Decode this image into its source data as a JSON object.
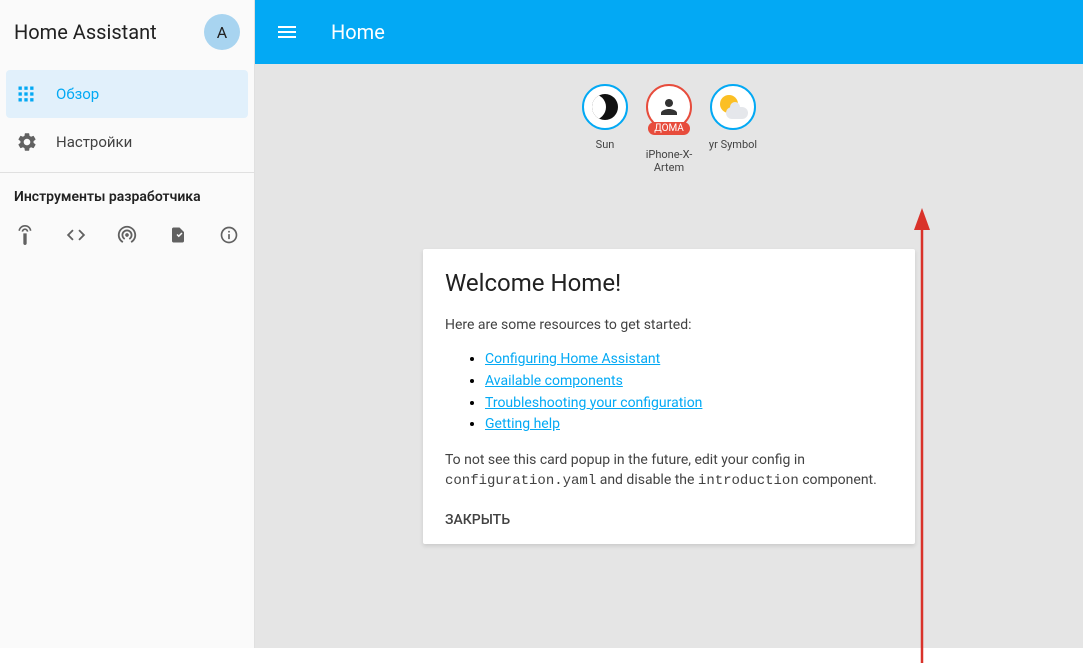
{
  "app": {
    "title": "Home Assistant",
    "avatar_initial": "A"
  },
  "sidebar": {
    "items": [
      {
        "label": "Обзор",
        "icon": "dashboard-icon",
        "active": true
      },
      {
        "label": "Настройки",
        "icon": "gear-icon",
        "active": false
      }
    ],
    "dev_section_label": "Инструменты разработчика",
    "dev_tools": [
      {
        "name": "remote-icon"
      },
      {
        "name": "code-icon"
      },
      {
        "name": "broadcast-icon"
      },
      {
        "name": "file-icon"
      },
      {
        "name": "info-icon"
      }
    ]
  },
  "header": {
    "page_title": "Home"
  },
  "badges": [
    {
      "id": "sun",
      "label": "Sun",
      "type": "sun"
    },
    {
      "id": "iphone",
      "label": "iPhone-X-Artem",
      "type": "person",
      "chip": "ДОМА"
    },
    {
      "id": "weather",
      "label": "yr Symbol",
      "type": "weather"
    }
  ],
  "welcome_card": {
    "title": "Welcome Home!",
    "intro": "Here are some resources to get started:",
    "links": [
      "Configuring Home Assistant",
      "Available components",
      "Troubleshooting your configuration",
      "Getting help"
    ],
    "footer_pre": "To not see this card popup in the future, edit your config in ",
    "footer_code1": "configuration.yaml",
    "footer_mid": " and disable the ",
    "footer_code2": "introduction",
    "footer_post": " component.",
    "dismiss": "ЗАКРЫТЬ"
  }
}
